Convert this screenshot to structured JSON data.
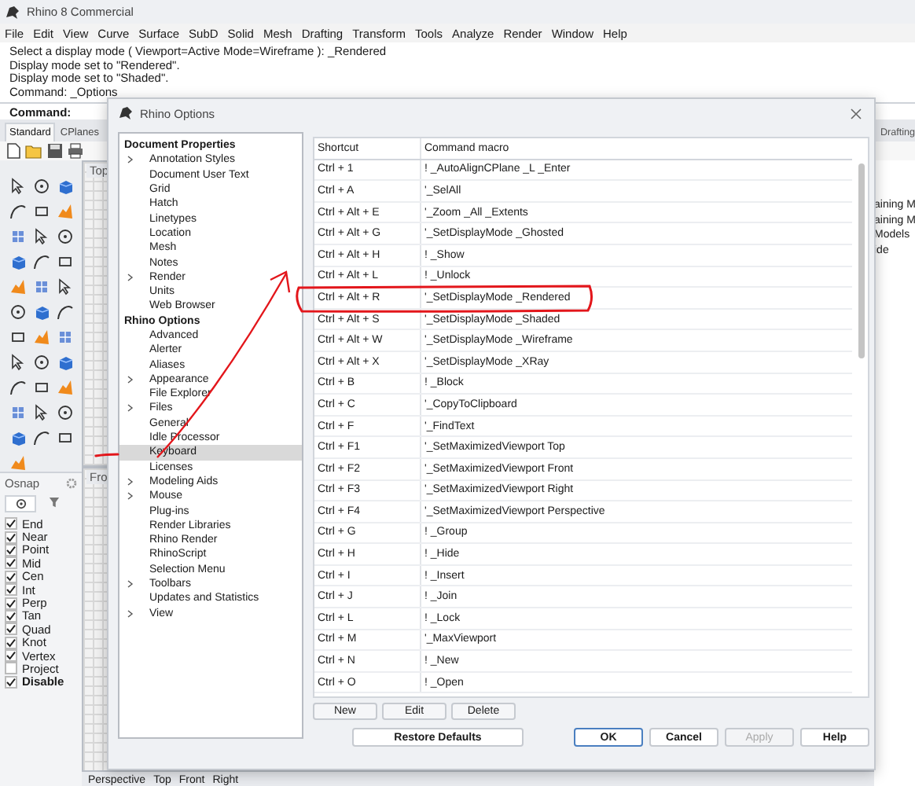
{
  "app": {
    "title": "Rhino 8 Commercial",
    "menu": [
      "File",
      "Edit",
      "View",
      "Curve",
      "Surface",
      "SubD",
      "Solid",
      "Mesh",
      "Drafting",
      "Transform",
      "Tools",
      "Analyze",
      "Render",
      "Window",
      "Help"
    ],
    "command_history": [
      "Select a display mode ( Viewport=Active  Mode=Wireframe ): _Rendered",
      "Display mode set to \"Rendered\".",
      "Display mode set to \"Shaded\".",
      "Command: _Options"
    ],
    "command_prompt": "Command:",
    "toolbar_tabs": [
      {
        "label": "Standard",
        "selected": true
      },
      {
        "label": "CPlanes",
        "selected": false
      }
    ],
    "right_tab": "Drafting",
    "right_panel_lines": [
      "aining M",
      "aining M",
      "Models",
      "ide"
    ],
    "viewports": [
      {
        "label": "Top"
      },
      {
        "label": "Fro"
      }
    ],
    "osnap": {
      "title": "Osnap",
      "items": [
        {
          "label": "End",
          "checked": true
        },
        {
          "label": "Near",
          "checked": true
        },
        {
          "label": "Point",
          "checked": true
        },
        {
          "label": "Mid",
          "checked": true
        },
        {
          "label": "Cen",
          "checked": true
        },
        {
          "label": "Int",
          "checked": true
        },
        {
          "label": "Perp",
          "checked": true
        },
        {
          "label": "Tan",
          "checked": true
        },
        {
          "label": "Quad",
          "checked": true
        },
        {
          "label": "Knot",
          "checked": true
        },
        {
          "label": "Vertex",
          "checked": true
        },
        {
          "label": "Project",
          "checked": false
        },
        {
          "label": "Disable",
          "checked": true
        }
      ]
    },
    "viewport_tabs": [
      "Perspective",
      "Top",
      "Front",
      "Right"
    ]
  },
  "dialog": {
    "title": "Rhino Options",
    "tree": [
      {
        "label": "Document Properties",
        "children": [
          {
            "label": "Annotation Styles",
            "expandable": true,
            "selected": false
          },
          {
            "label": "Document User Text",
            "expandable": false,
            "selected": false
          },
          {
            "label": "Grid",
            "expandable": false,
            "selected": false
          },
          {
            "label": "Hatch",
            "expandable": false,
            "selected": false
          },
          {
            "label": "Linetypes",
            "expandable": false,
            "selected": false
          },
          {
            "label": "Location",
            "expandable": false,
            "selected": false
          },
          {
            "label": "Mesh",
            "expandable": false,
            "selected": false
          },
          {
            "label": "Notes",
            "expandable": false,
            "selected": false
          },
          {
            "label": "Render",
            "expandable": true,
            "selected": false
          },
          {
            "label": "Units",
            "expandable": false,
            "selected": false
          },
          {
            "label": "Web Browser",
            "expandable": false,
            "selected": false
          }
        ]
      },
      {
        "label": "Rhino Options",
        "children": [
          {
            "label": "Advanced",
            "expandable": false,
            "selected": false
          },
          {
            "label": "Alerter",
            "expandable": false,
            "selected": false
          },
          {
            "label": "Aliases",
            "expandable": false,
            "selected": false
          },
          {
            "label": "Appearance",
            "expandable": true,
            "selected": false
          },
          {
            "label": "File Explorer",
            "expandable": false,
            "selected": false
          },
          {
            "label": "Files",
            "expandable": true,
            "selected": false
          },
          {
            "label": "General",
            "expandable": false,
            "selected": false
          },
          {
            "label": "Idle Processor",
            "expandable": false,
            "selected": false
          },
          {
            "label": "Keyboard",
            "expandable": false,
            "selected": true
          },
          {
            "label": "Licenses",
            "expandable": false,
            "selected": false
          },
          {
            "label": "Modeling Aids",
            "expandable": true,
            "selected": false
          },
          {
            "label": "Mouse",
            "expandable": true,
            "selected": false
          },
          {
            "label": "Plug-ins",
            "expandable": false,
            "selected": false
          },
          {
            "label": "Render Libraries",
            "expandable": false,
            "selected": false
          },
          {
            "label": "Rhino Render",
            "expandable": false,
            "selected": false
          },
          {
            "label": "RhinoScript",
            "expandable": false,
            "selected": false
          },
          {
            "label": "Selection Menu",
            "expandable": false,
            "selected": false
          },
          {
            "label": "Toolbars",
            "expandable": true,
            "selected": false
          },
          {
            "label": "Updates and Statistics",
            "expandable": false,
            "selected": false
          },
          {
            "label": "View",
            "expandable": true,
            "selected": false
          }
        ]
      }
    ],
    "table": {
      "columns": [
        "Shortcut",
        "Command macro"
      ],
      "rows": [
        {
          "shortcut": "Ctrl + 1",
          "macro": "! _AutoAlignCPlane _L _Enter"
        },
        {
          "shortcut": "Ctrl + A",
          "macro": "'_SelAll"
        },
        {
          "shortcut": "Ctrl + Alt + E",
          "macro": "'_Zoom _All _Extents"
        },
        {
          "shortcut": "Ctrl + Alt + G",
          "macro": "'_SetDisplayMode _Ghosted"
        },
        {
          "shortcut": "Ctrl + Alt + H",
          "macro": "! _Show"
        },
        {
          "shortcut": "Ctrl + Alt + L",
          "macro": "! _Unlock"
        },
        {
          "shortcut": "Ctrl + Alt + R",
          "macro": "'_SetDisplayMode _Rendered"
        },
        {
          "shortcut": "Ctrl + Alt + S",
          "macro": "'_SetDisplayMode _Shaded"
        },
        {
          "shortcut": "Ctrl + Alt + W",
          "macro": "'_SetDisplayMode _Wireframe"
        },
        {
          "shortcut": "Ctrl + Alt + X",
          "macro": "'_SetDisplayMode _XRay"
        },
        {
          "shortcut": "Ctrl + B",
          "macro": "! _Block"
        },
        {
          "shortcut": "Ctrl + C",
          "macro": "'_CopyToClipboard"
        },
        {
          "shortcut": "Ctrl + F",
          "macro": "'_FindText"
        },
        {
          "shortcut": "Ctrl + F1",
          "macro": "'_SetMaximizedViewport Top"
        },
        {
          "shortcut": "Ctrl + F2",
          "macro": "'_SetMaximizedViewport Front"
        },
        {
          "shortcut": "Ctrl + F3",
          "macro": "'_SetMaximizedViewport Right"
        },
        {
          "shortcut": "Ctrl + F4",
          "macro": "'_SetMaximizedViewport Perspective"
        },
        {
          "shortcut": "Ctrl + G",
          "macro": "! _Group"
        },
        {
          "shortcut": "Ctrl + H",
          "macro": "! _Hide"
        },
        {
          "shortcut": "Ctrl + I",
          "macro": "! _Insert"
        },
        {
          "shortcut": "Ctrl + J",
          "macro": "! _Join"
        },
        {
          "shortcut": "Ctrl + L",
          "macro": "! _Lock"
        },
        {
          "shortcut": "Ctrl + M",
          "macro": "'_MaxViewport"
        },
        {
          "shortcut": "Ctrl + N",
          "macro": "! _New"
        },
        {
          "shortcut": "Ctrl + O",
          "macro": "! _Open"
        }
      ]
    },
    "table_buttons": [
      {
        "label": "New"
      },
      {
        "label": "Edit"
      },
      {
        "label": "Delete"
      }
    ],
    "footer_buttons": [
      {
        "label": "Restore Defaults",
        "default": false,
        "disabled": false
      },
      {
        "label": "OK",
        "default": true,
        "disabled": false
      },
      {
        "label": "Cancel",
        "default": false,
        "disabled": false
      },
      {
        "label": "Apply",
        "default": false,
        "disabled": true
      },
      {
        "label": "Help",
        "default": false,
        "disabled": false
      }
    ]
  }
}
